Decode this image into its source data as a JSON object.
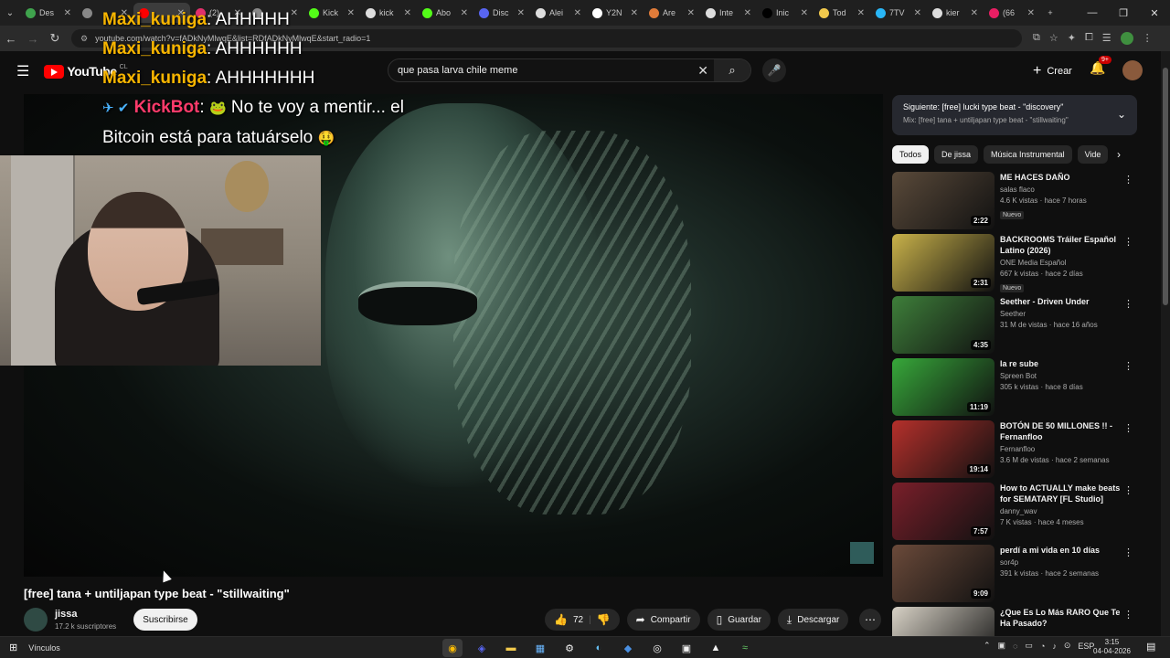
{
  "browser": {
    "tabs": [
      {
        "label": "Des",
        "color": "#3fa34d"
      },
      {
        "label": "",
        "color": "#888888"
      },
      {
        "label": "",
        "color": "#ff0000",
        "active": true
      },
      {
        "label": "(2)",
        "color": "#e1306c"
      },
      {
        "label": "",
        "color": "#888888"
      },
      {
        "label": "Kick",
        "color": "#53fc18"
      },
      {
        "label": "kick",
        "color": "#dddddd"
      },
      {
        "label": "Abo",
        "color": "#53fc18"
      },
      {
        "label": "Disc",
        "color": "#5865f2"
      },
      {
        "label": "Alei",
        "color": "#dddddd"
      },
      {
        "label": "Y2N",
        "color": "#ffffff"
      },
      {
        "label": "Are",
        "color": "#e07b39"
      },
      {
        "label": "Inte",
        "color": "#dddddd"
      },
      {
        "label": "Inic",
        "color": "#000000"
      },
      {
        "label": "Tod",
        "color": "#f2c94c"
      },
      {
        "label": "7TV",
        "color": "#29b6f6"
      },
      {
        "label": "kier",
        "color": "#dddddd"
      },
      {
        "label": "(66",
        "color": "#e91e63"
      }
    ],
    "new_tab": "+",
    "url": "youtube.com/watch?v=fADkNyMlwqE&list=RDfADkNyMlwqE&start_radio=1"
  },
  "header": {
    "logo_word": "YouTube",
    "country": "CL",
    "search_value": "que pasa larva chile meme",
    "create_label": "Crear",
    "notifications_badge": "9+"
  },
  "chat": {
    "lines": [
      {
        "user": "Maxi_kuniga",
        "message": "AHHHHH"
      },
      {
        "user": "Maxi_kuniga",
        "message": "AHHHHHH"
      },
      {
        "user": "Maxi_kuniga",
        "message": "AHHHHHHH"
      }
    ],
    "bot_user": "KickBot",
    "bot_line1": "No te voy a mentir... el",
    "bot_line2": "Bitcoin está para tatuárselo"
  },
  "video": {
    "title": "[free] tana + untiljapan type beat - \"stillwaiting\"",
    "channel": "jissa",
    "subscribers": "17.2 k suscriptores",
    "subscribe_label": "Suscribirse",
    "likes": "72",
    "share_label": "Compartir",
    "save_label": "Guardar",
    "download_label": "Descargar"
  },
  "up_next": {
    "line1": "Siguiente: [free] lucki type beat - \"discovery\"",
    "line2": "Mix: [free] tana + untiljapan type beat - \"stillwaiting\""
  },
  "chips": [
    "Todos",
    "De jissa",
    "Música Instrumental",
    "Vide"
  ],
  "recommendations": [
    {
      "title": "ME HACES DAÑO",
      "channel": "salas flaco",
      "meta": "4.6 K vistas · hace 7 horas",
      "badge": "Nuevo",
      "duration": "2:22",
      "thumb_color": "#5a4a3a"
    },
    {
      "title": "BACKROOMS Tráiler Español Latino (2026)",
      "channel": "ONE Media Español",
      "meta": "667 k vistas · hace 2 días",
      "badge": "Nuevo",
      "duration": "2:31",
      "thumb_color": "#c9b24a"
    },
    {
      "title": "Seether - Driven Under",
      "channel": "Seether",
      "meta": "31 M de vistas · hace 16 años",
      "badge": "",
      "duration": "4:35",
      "thumb_color": "#3e7f3a"
    },
    {
      "title": "la re sube",
      "channel": "Spreen Bot",
      "meta": "305 k vistas · hace 8 días",
      "badge": "",
      "duration": "11:19",
      "thumb_color": "#37a83a"
    },
    {
      "title": "BOTÓN DE 50 MILLONES !! - Fernanfloo",
      "channel": "Fernanfloo",
      "meta": "3.6 M de vistas · hace 2 semanas",
      "badge": "",
      "duration": "19:14",
      "thumb_color": "#b5302b"
    },
    {
      "title": "How to ACTUALLY make beats for SEMATARY [FL Studio]",
      "channel": "danny_wav",
      "meta": "7 K vistas · hace 4 meses",
      "badge": "",
      "duration": "7:57",
      "thumb_color": "#7a1f2a"
    },
    {
      "title": "perdí a mi vida en 10 días",
      "channel": "sor4p",
      "meta": "391 k vistas · hace 2 semanas",
      "badge": "",
      "duration": "9:09",
      "thumb_color": "#6b4a3a"
    },
    {
      "title": "¿Que Es Lo Más RARO Que Te Ha Pasado?",
      "channel": "",
      "meta": "",
      "badge": "",
      "duration": "",
      "thumb_color": "#d8d2c6"
    }
  ],
  "taskbar": {
    "label": "Vínculos",
    "lang": "ESP",
    "time": "3:15",
    "date": "04-04-2026"
  }
}
